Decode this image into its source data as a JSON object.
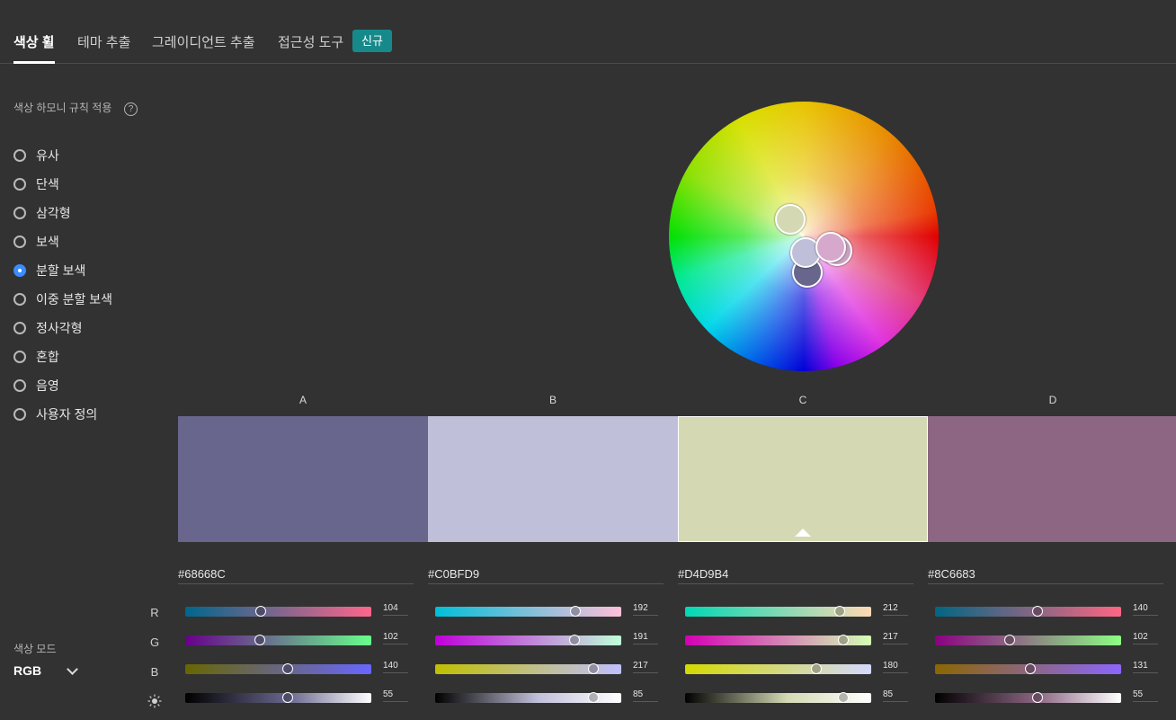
{
  "tabs": [
    {
      "label": "색상 휠",
      "active": true
    },
    {
      "label": "테마 추출",
      "active": false
    },
    {
      "label": "그레이디언트 추출",
      "active": false
    },
    {
      "label": "접근성 도구",
      "active": false
    }
  ],
  "badge": "신규",
  "sidebar": {
    "harmony_title": "색상 하모니 규칙 적용",
    "help_icon": "?",
    "rules": [
      {
        "label": "유사",
        "checked": false
      },
      {
        "label": "단색",
        "checked": false
      },
      {
        "label": "삼각형",
        "checked": false
      },
      {
        "label": "보색",
        "checked": false
      },
      {
        "label": "분할 보색",
        "checked": true
      },
      {
        "label": "이중 분할 보색",
        "checked": false
      },
      {
        "label": "정사각형",
        "checked": false
      },
      {
        "label": "혼합",
        "checked": false
      },
      {
        "label": "음영",
        "checked": false
      },
      {
        "label": "사용자 정의",
        "checked": false
      }
    ],
    "mode_label": "색상 모드",
    "mode_value": "RGB"
  },
  "swatches": [
    {
      "letter": "A",
      "hex": "#68668C",
      "color": "#68668C",
      "r": 104,
      "g": 102,
      "b": 140,
      "brightness": 55
    },
    {
      "letter": "B",
      "hex": "#C0BFD9",
      "color": "#C0BFD9",
      "r": 192,
      "g": 191,
      "b": 217,
      "brightness": 85
    },
    {
      "letter": "C",
      "hex": "#D4D9B4",
      "color": "#D4D9B4",
      "r": 212,
      "g": 217,
      "b": 180,
      "brightness": 85,
      "selected": true
    },
    {
      "letter": "D",
      "hex": "#8C6683",
      "color": "#8C6683",
      "r": 140,
      "g": 102,
      "b": 131,
      "brightness": 55
    }
  ],
  "channel_labels": {
    "r": "R",
    "g": "G",
    "b": "B"
  }
}
